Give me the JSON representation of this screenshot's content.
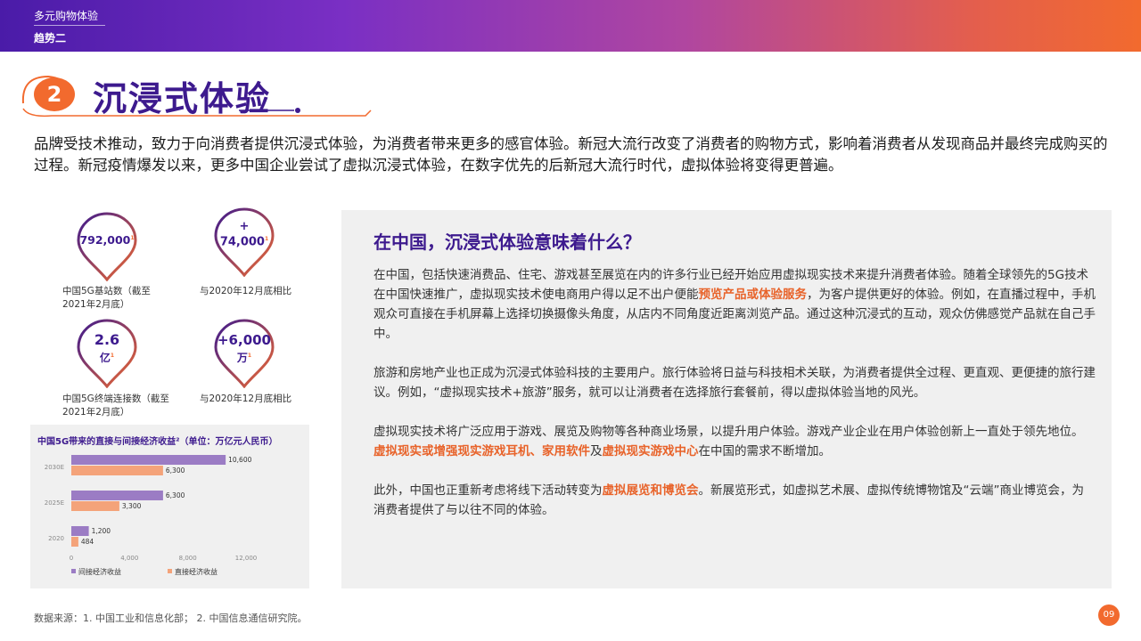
{
  "header": {
    "section": "多元购物体验",
    "trend": "趋势二"
  },
  "title": {
    "number": "2",
    "text": "沉浸式体验"
  },
  "intro": "品牌受技术推动，致力于向消费者提供沉浸式体验，为消费者带来更多的感官体验。新冠大流行改变了消费者的购物方式，影响着消费者从发现商品并最终完成购买的过程。新冠疫情爆发以来，更多中国企业尝试了虚拟沉浸式体验，在数字优先的后新冠大流行时代，虚拟体验将变得更普遍。",
  "stats": [
    {
      "value": "792,000",
      "sup": "1",
      "caption": "中国5G基站数（截至2021年2月底）"
    },
    {
      "value_line1": "+",
      "value_line2": "74,000",
      "sup": "1",
      "caption": "与2020年12月底相比"
    },
    {
      "value_line1": "2.6",
      "value_line2": "亿",
      "sup": "1",
      "caption": "中国5G终端连接数（截至2021年2月底）"
    },
    {
      "value_line1": "+6,000",
      "value_line2": "万",
      "sup": "1",
      "caption": "与2020年12月底相比"
    }
  ],
  "chart_data": {
    "type": "bar",
    "orientation": "horizontal",
    "title": "中国5G带来的直接与间接经济收益²（单位：万亿元人民币）",
    "categories": [
      "2030E",
      "2025E",
      "2020"
    ],
    "series": [
      {
        "name": "间接经济收益",
        "color": "#9b7cc4",
        "values": [
          10600,
          6300,
          1200
        ]
      },
      {
        "name": "直接经济收益",
        "color": "#f4a37a",
        "values": [
          6300,
          3300,
          484
        ]
      }
    ],
    "data_labels": [
      [
        "10,600",
        "6,300"
      ],
      [
        "6,300",
        "3,300"
      ],
      [
        "1,200",
        "484"
      ]
    ],
    "xlim": [
      0,
      12000
    ],
    "xticks": [
      "0",
      "4,000",
      "8,000",
      "12,000"
    ],
    "legend": "bottom"
  },
  "panel": {
    "title": "在中国，沉浸式体验意味着什么？",
    "p1_a": "在中国，包括快速消费品、住宅、游戏甚至展览在内的许多行业已经开始应用虚拟现实技术来提升消费者体验。随着全球领先的5G技术在中国快速推广，虚拟现实技术使电商用户得以足不出户便能",
    "p1_hl": "预览产品或体验服务",
    "p1_b": "，为客户提供更好的体验。例如，在直播过程中，手机观众可直接在手机屏幕上选择切换摄像头角度，从店内不同角度近距离浏览产品。通过这种沉浸式的互动，观众仿佛感觉产品就在自己手中。",
    "p2": "旅游和房地产业也正成为沉浸式体验科技的主要用户。旅行体验将日益与科技相术关联，为消费者提供全过程、更直观、更便捷的旅行建议。例如，“虚拟现实技术+旅游”服务，就可以让消费者在选择旅行套餐前，得以虚拟体验当地的风光。",
    "p3_a": "虚拟现实技术将广泛应用于游戏、展览及购物等各种商业场景，以提升用户体验。游戏产业企业在用户体验创新上一直处于领先地位。",
    "p3_hl1": "虚拟现实或增强现实游戏耳机、家用软件",
    "p3_mid": "及",
    "p3_hl2": "虚拟现实游戏中心",
    "p3_b": "在中国的需求不断增加。",
    "p4_a": "此外，中国也正重新考虑将线下活动转变为",
    "p4_hl": "虚拟展览和博览会",
    "p4_b": "。新展览形式，如虚拟艺术展、虚拟传统博物馆及“云端”商业博览会，为消费者提供了与以往不同的体验。"
  },
  "source": "数据来源：1. 中国工业和信息化部； 2. 中国信息通信研究院。",
  "page": "09",
  "colors": {
    "purple": "#3d1a8e",
    "orange": "#f26a2e",
    "bar_indirect": "#9b7cc4",
    "bar_direct": "#f4a37a"
  }
}
